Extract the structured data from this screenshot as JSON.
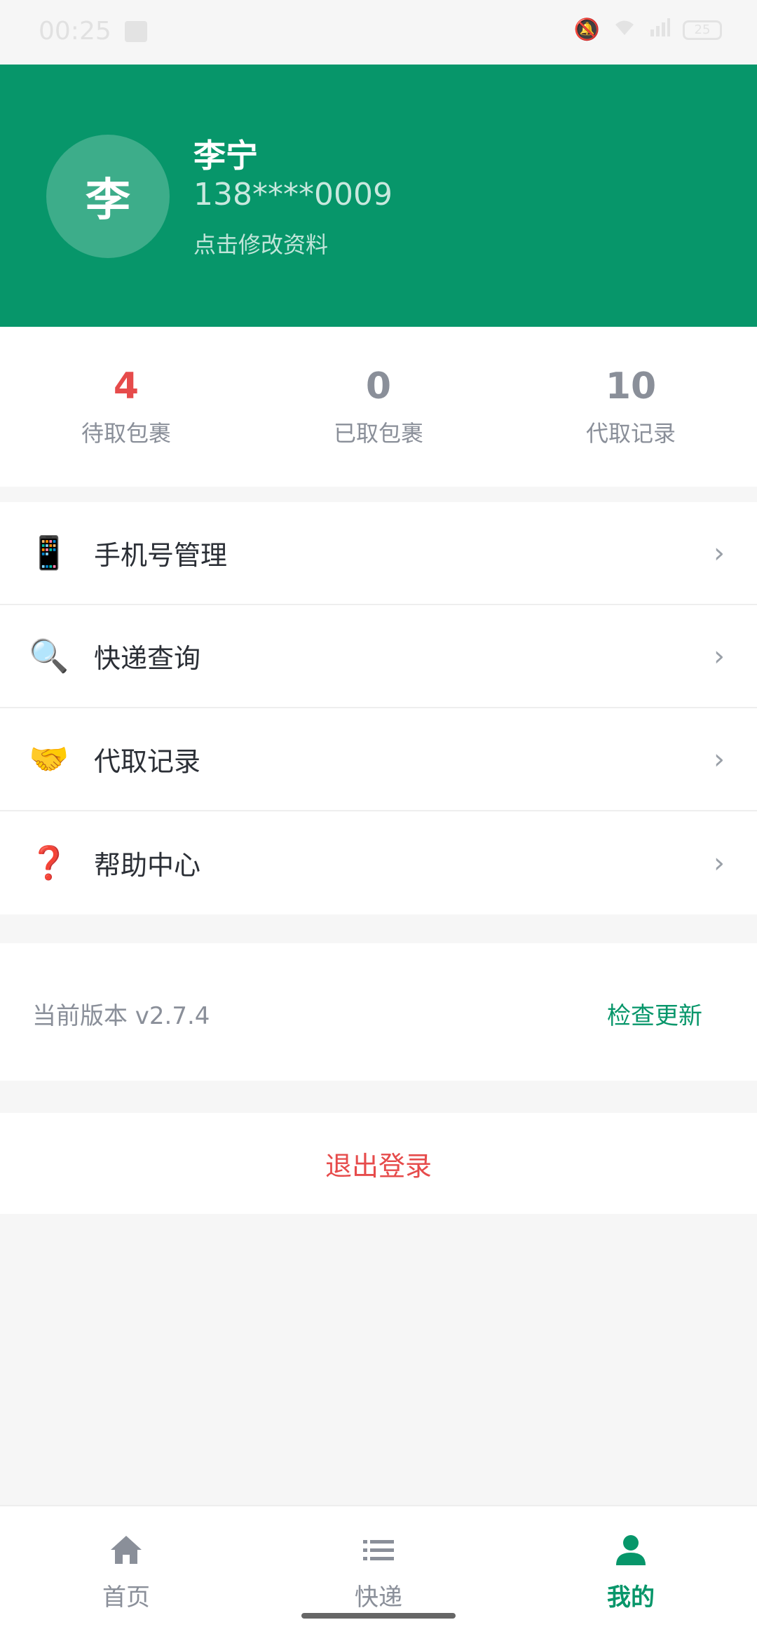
{
  "status_bar": {
    "time": "00:25",
    "battery": "25"
  },
  "profile": {
    "avatar_text": "李",
    "name": "李宁",
    "phone": "138****0009",
    "edit_link": "点击修改资料"
  },
  "stats": [
    {
      "value": "4",
      "label": "待取包裹"
    },
    {
      "value": "0",
      "label": "已取包裹"
    },
    {
      "value": "10",
      "label": "代取记录"
    }
  ],
  "menu": [
    {
      "icon": "📱",
      "icon_name": "phone-icon",
      "label": "手机号管理"
    },
    {
      "icon": "🔍",
      "icon_name": "magnifier-icon",
      "label": "快递查询"
    },
    {
      "icon": "🤝",
      "icon_name": "handshake-icon",
      "label": "代取记录"
    },
    {
      "icon": "❓",
      "icon_name": "question-icon",
      "label": "帮助中心"
    }
  ],
  "chevron": "›",
  "version": {
    "text": "当前版本 v2.7.4",
    "check_update": "检查更新"
  },
  "logout": "退出登录",
  "bottom_nav": [
    {
      "label": "首页",
      "icon": "home-icon"
    },
    {
      "label": "快递",
      "icon": "list-icon"
    },
    {
      "label": "我的",
      "icon": "person-icon",
      "active": true
    }
  ],
  "colors": {
    "brand": "#07966a",
    "alert": "#e64b4b"
  }
}
